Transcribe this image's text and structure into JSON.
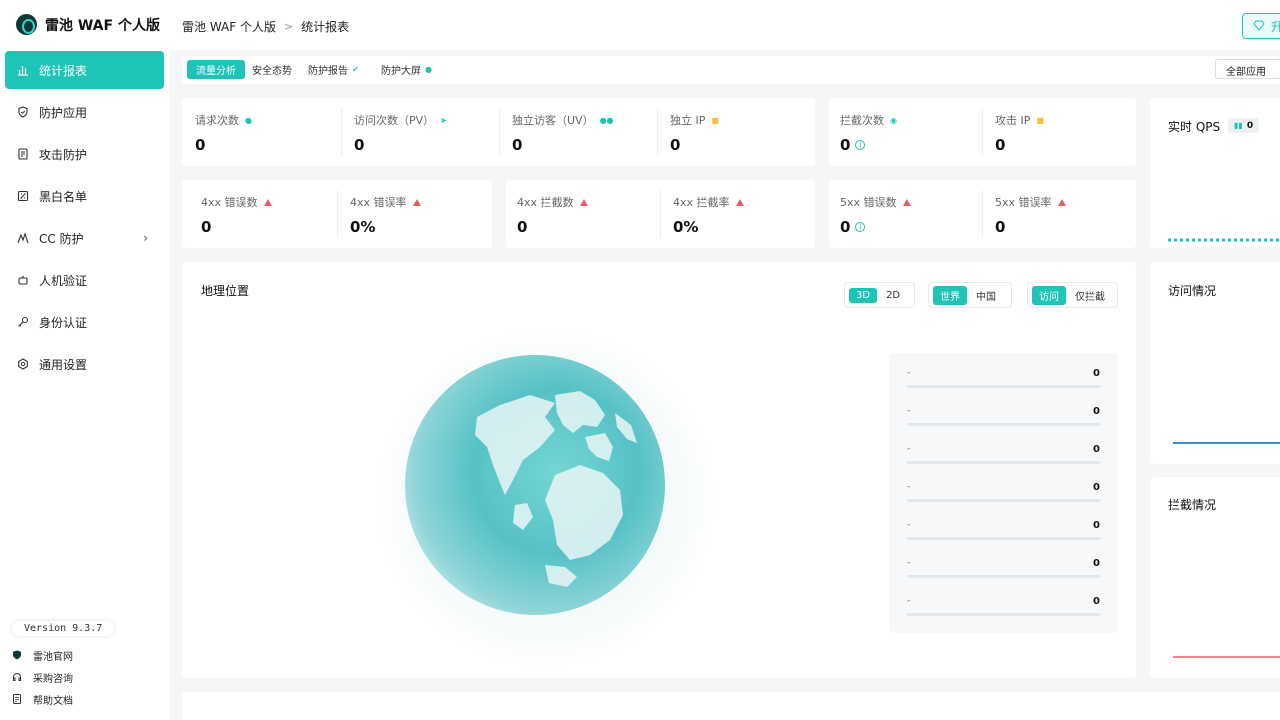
{
  "app": {
    "name": "雷池 WAF 个人版"
  },
  "sidebar": {
    "items": [
      {
        "label": "统计报表",
        "icon": "bar-chart-icon",
        "active": true
      },
      {
        "label": "防护应用",
        "icon": "shield-icon",
        "active": false
      },
      {
        "label": "攻击防护",
        "icon": "document-icon",
        "active": false
      },
      {
        "label": "黑白名单",
        "icon": "list-icon",
        "active": false
      },
      {
        "label": "CC 防护",
        "icon": "wave-icon",
        "active": false
      },
      {
        "label": "人机验证",
        "icon": "robot-icon",
        "active": false
      },
      {
        "label": "身份认证",
        "icon": "key-icon",
        "active": false
      },
      {
        "label": "通用设置",
        "icon": "gear-icon",
        "active": false
      }
    ],
    "version": "Version 9.3.7",
    "footer_links": [
      {
        "label": "雷池官网",
        "icon": "shield-icon"
      },
      {
        "label": "采购咨询",
        "icon": "headset-icon"
      },
      {
        "label": "帮助文档",
        "icon": "document-icon"
      }
    ]
  },
  "header": {
    "breadcrumb": [
      "雷池 WAF 个人版",
      "统计报表"
    ],
    "button_label": "升"
  },
  "tabs": [
    {
      "label": "流量分析",
      "active": true
    },
    {
      "label": "安全态势",
      "active": false
    },
    {
      "label": "防护报告",
      "active": false
    },
    {
      "label": "防护大屏",
      "active": false
    }
  ],
  "app_select": {
    "value": "全部应用"
  },
  "metrics_row1_left": [
    {
      "label": "请求次数",
      "value": "0"
    },
    {
      "label": "访问次数（PV）",
      "value": "0"
    },
    {
      "label": "独立访客（UV）",
      "value": "0"
    },
    {
      "label": "独立 IP",
      "value": "0"
    }
  ],
  "metrics_row1_right": [
    {
      "label": "拦截次数",
      "value": "0"
    },
    {
      "label": "攻击 IP",
      "value": "0"
    }
  ],
  "metrics_row2": [
    {
      "label": "4xx 错误数",
      "value": "0"
    },
    {
      "label": "4xx 错误率",
      "value": "0%"
    },
    {
      "label": "4xx 拦截数",
      "value": "0"
    },
    {
      "label": "4xx 拦截率",
      "value": "0%"
    },
    {
      "label": "5xx 错误数",
      "value": "0"
    },
    {
      "label": "5xx 错误率",
      "value": "0"
    }
  ],
  "geo": {
    "title": "地理位置",
    "view_toggle": [
      "3D",
      "2D"
    ],
    "region_toggle": [
      "世界",
      "中国"
    ],
    "type_toggle": [
      "访问",
      "仅拦截"
    ],
    "ranking": [
      {
        "name": "-",
        "value": "0"
      },
      {
        "name": "-",
        "value": "0"
      },
      {
        "name": "-",
        "value": "0"
      },
      {
        "name": "-",
        "value": "0"
      },
      {
        "name": "-",
        "value": "0"
      },
      {
        "name": "-",
        "value": "0"
      },
      {
        "name": "-",
        "value": "0"
      }
    ]
  },
  "right_panels": {
    "qps_title": "实时 QPS",
    "qps_value": "0",
    "visits_title": "访问情况",
    "blocks_title": "拦截情况"
  },
  "colors": {
    "accent": "#1ec4b6",
    "danger": "#e85d5d",
    "warning": "#f5c242",
    "blue_line": "#3a8fd1",
    "red_line": "#e88a8a"
  }
}
